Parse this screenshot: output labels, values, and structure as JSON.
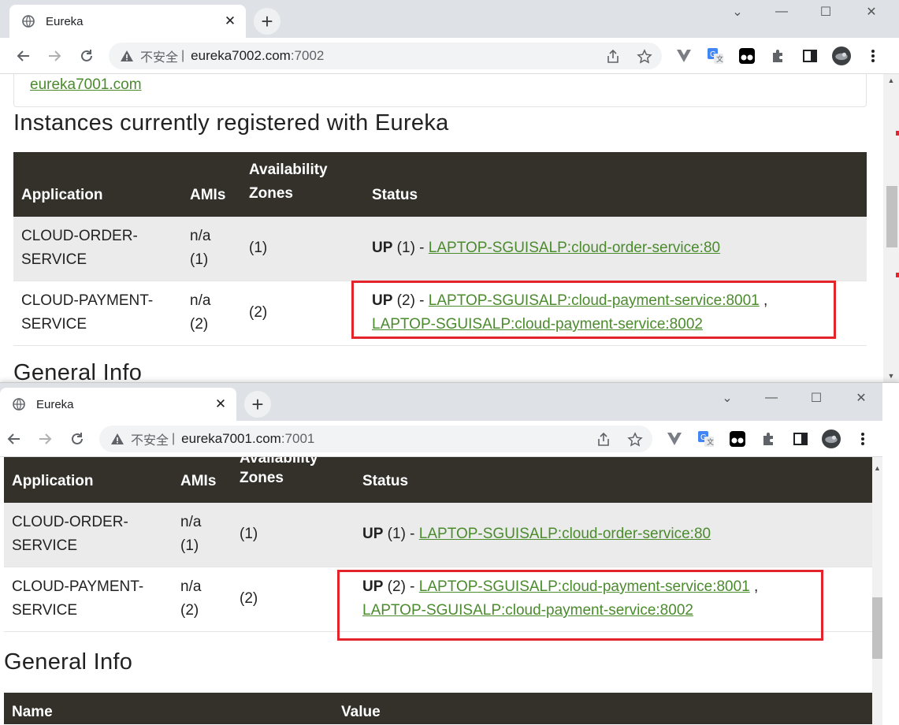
{
  "window_top": {
    "tab_title": "Eureka",
    "tab_close": "✕",
    "new_tab": "+",
    "insecure_label": "不安全",
    "url_host": "eureka7002.com",
    "url_port": ":7002",
    "top_link": "eureka7001.com",
    "section_title": "Instances currently registered with Eureka",
    "next_section_title": "General Info"
  },
  "window_bottom": {
    "tab_title": "Eureka",
    "tab_close": "✕",
    "new_tab": "+",
    "insecure_label": "不安全",
    "url_host": "eureka7001.com",
    "url_port": ":7001",
    "section_title": "General Info",
    "info_table": {
      "col_name": "Name",
      "col_value": "Value"
    }
  },
  "window_controls": {
    "minimize": "—",
    "maximize": "☐",
    "close": "✕",
    "dropdown": "⌄"
  },
  "instances_table": {
    "headers": {
      "application": "Application",
      "amis": "AMIs",
      "zones_line1": "Availability",
      "zones_line2": "Zones",
      "status": "Status"
    },
    "rows": [
      {
        "app_line1": "CLOUD-ORDER-",
        "app_line2": "SERVICE",
        "amis_line1": "n/a",
        "amis_line2": "(1)",
        "zones": "(1)",
        "status_prefix": "UP",
        "status_count": " (1) - ",
        "links": [
          "LAPTOP-SGUISALP:cloud-order-service:80"
        ]
      },
      {
        "app_line1": "CLOUD-PAYMENT-",
        "app_line2": "SERVICE",
        "amis_line1": "n/a",
        "amis_line2": "(2)",
        "zones": "(2)",
        "status_prefix": "UP",
        "status_count": " (2) - ",
        "links": [
          "LAPTOP-SGUISALP:cloud-payment-service:8001",
          "LAPTOP-SGUISALP:cloud-payment-service:8002"
        ],
        "link_separator": " ,"
      }
    ]
  },
  "colors": {
    "table_header_bg": "#34312b",
    "link": "#4a8b2c",
    "highlight_box": "#e3242b",
    "tabstrip": "#dee1e6"
  },
  "icons": [
    "globe-icon",
    "back-icon",
    "forward-icon",
    "reload-icon",
    "warning-icon",
    "share-icon",
    "star-icon",
    "vue-devtools-icon",
    "translate-icon",
    "tampermonkey-icon",
    "extensions-icon",
    "sidepanel-icon",
    "profile-avatar-icon",
    "menu-icon"
  ]
}
